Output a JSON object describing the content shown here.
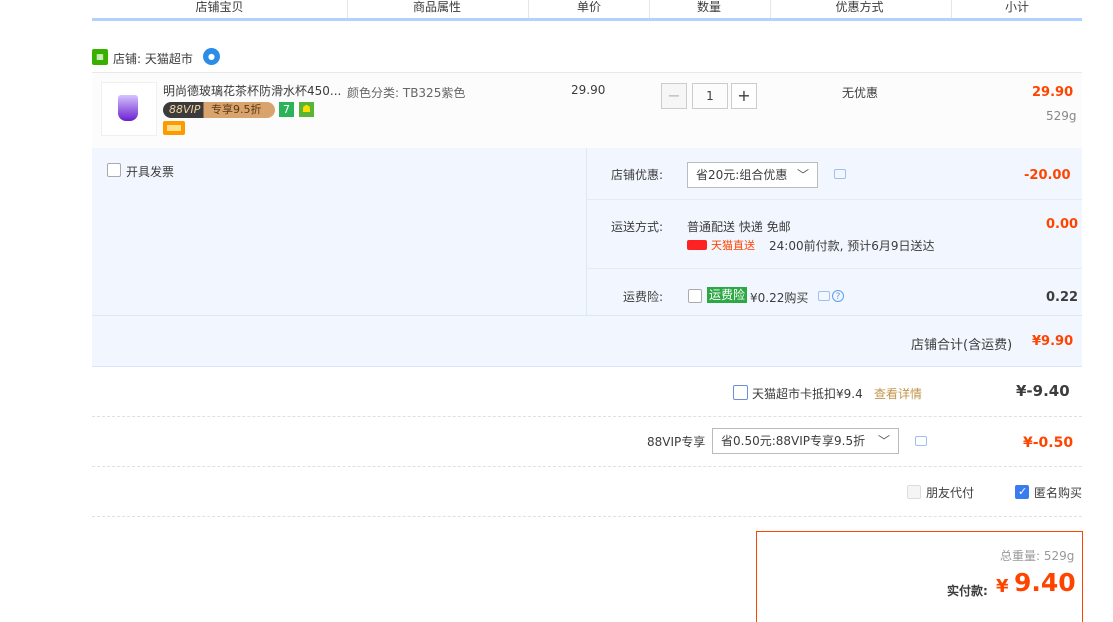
{
  "header": {
    "columns": [
      "店铺宝贝",
      "商品属性",
      "单价",
      "数量",
      "优惠方式",
      "小计"
    ]
  },
  "shop": {
    "name": "店铺: 天猫超市"
  },
  "item": {
    "title": "明尚德玻璃花茶杯防滑水杯450...",
    "vip_badge_left": "88VIP",
    "vip_badge_right": "专享9.5折",
    "badge_seven": "7",
    "attr": "颜色分类: TB325紫色",
    "price": "29.90",
    "quantity": "1",
    "qty_minus": "−",
    "qty_plus": "+",
    "discount": "无优惠",
    "subtotal": "29.90",
    "weight": "529g"
  },
  "invoice": {
    "label": "开具发票"
  },
  "shop_discount": {
    "label": "店铺优惠:",
    "selected": "省20元:组合优惠",
    "value": "-20.00"
  },
  "shipping": {
    "label": "运送方式:",
    "method": "普通配送 快递 免邮",
    "badge": "天猫直送",
    "note": "24:00前付款, 预计6月9日送达",
    "value": "0.00"
  },
  "insurance": {
    "label": "运费险:",
    "tag": "运费险",
    "price": "¥0.22购买",
    "value": "0.22"
  },
  "shop_total": {
    "label": "店铺合计(含运费)",
    "value": "¥9.90"
  },
  "card_deduct": {
    "label": "天猫超市卡抵扣¥9.4",
    "link": "查看详情",
    "value": "¥-9.40"
  },
  "vip_discount": {
    "label": "88VIP专享",
    "selected": "省0.50元:88VIP专享9.5折",
    "value": "¥-0.50"
  },
  "options": {
    "friend_pay": "朋友代付",
    "anonymous": "匿名购买"
  },
  "final": {
    "weight_label": "总重量: 529g",
    "pay_label": "实付款:",
    "currency": "¥",
    "amount": "9.40"
  },
  "colors": {
    "price_red": "#ff4400",
    "header_blue": "#b2d1ff",
    "panel_bg": "#f2f7ff"
  }
}
